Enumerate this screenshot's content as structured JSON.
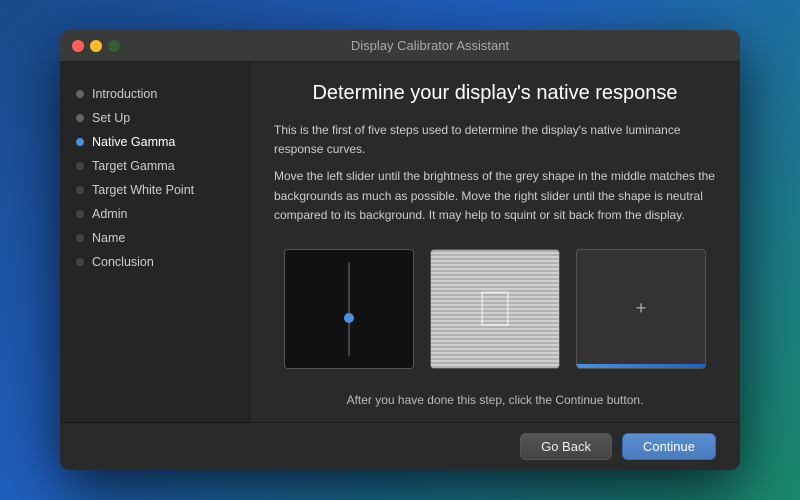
{
  "window": {
    "title": "Display Calibrator Assistant",
    "traffic_lights": {
      "close_label": "close",
      "minimize_label": "minimize",
      "maximize_label": "maximize"
    }
  },
  "sidebar": {
    "items": [
      {
        "id": "introduction",
        "label": "Introduction",
        "dot": "gray",
        "active": false
      },
      {
        "id": "setup",
        "label": "Set Up",
        "dot": "gray",
        "active": false
      },
      {
        "id": "native-gamma",
        "label": "Native Gamma",
        "dot": "blue",
        "active": true
      },
      {
        "id": "target-gamma",
        "label": "Target Gamma",
        "dot": "dim",
        "active": false
      },
      {
        "id": "target-white-point",
        "label": "Target White Point",
        "dot": "dim",
        "active": false
      },
      {
        "id": "admin",
        "label": "Admin",
        "dot": "dim",
        "active": false
      },
      {
        "id": "name",
        "label": "Name",
        "dot": "dim",
        "active": false
      },
      {
        "id": "conclusion",
        "label": "Conclusion",
        "dot": "dim",
        "active": false
      }
    ]
  },
  "main": {
    "title": "Determine your display's native response",
    "description1": "This is the first of five steps used to determine the display's native luminance response curves.",
    "description2": "Move the left slider until the brightness of the grey shape in the middle matches the backgrounds as much as possible. Move the right slider until the shape is neutral compared to its background. It may help to squint or sit back from the display.",
    "instruction_bottom": "After you have done this step, click the Continue button."
  },
  "footer": {
    "go_back_label": "Go Back",
    "continue_label": "Continue"
  }
}
